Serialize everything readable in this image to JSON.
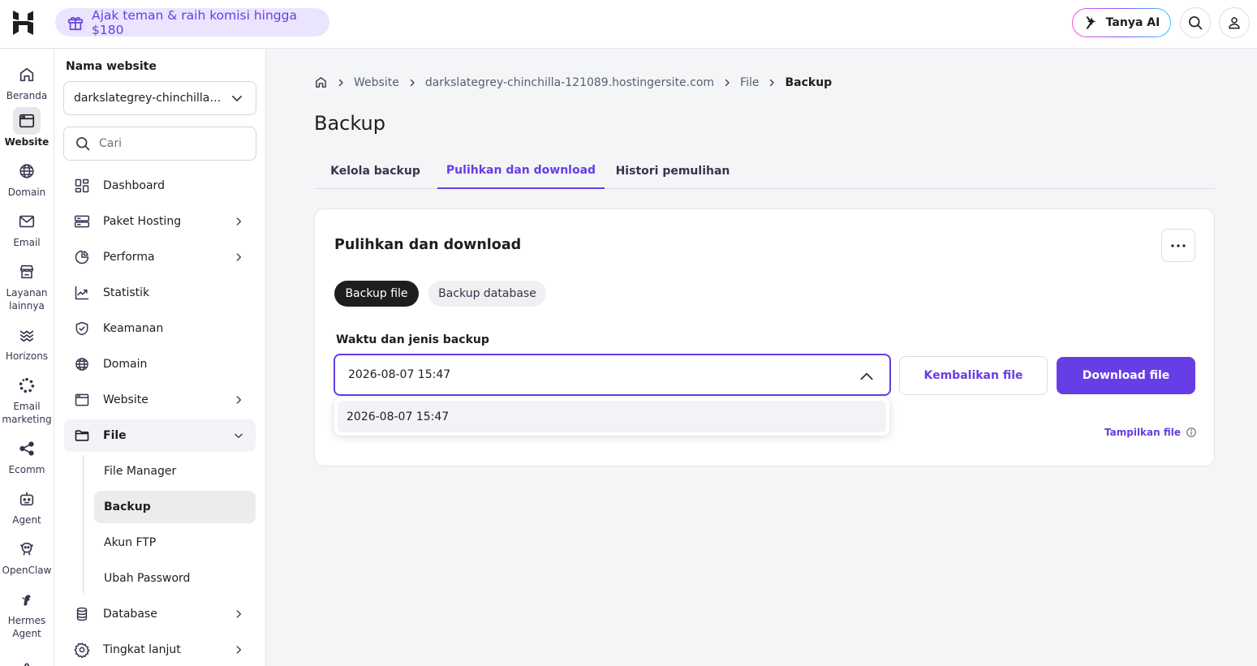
{
  "topbar": {
    "promo_text": "Ajak teman & raih komisi hingga $180",
    "ai_button": "Tanya AI"
  },
  "rail": {
    "items": [
      {
        "label": "Beranda",
        "icon": "home-icon"
      },
      {
        "label": "Website",
        "icon": "browser-icon"
      },
      {
        "label": "Domain",
        "icon": "globe-icon"
      },
      {
        "label": "Email",
        "icon": "mail-icon"
      },
      {
        "label": "Layanan lainnya",
        "icon": "store-icon"
      },
      {
        "label": "Horizons",
        "icon": "horizons-icon"
      },
      {
        "label": "Email marketing",
        "icon": "email-marketing-icon"
      },
      {
        "label": "Ecomm",
        "icon": "share-icon"
      },
      {
        "label": "Agent",
        "icon": "robot-icon"
      },
      {
        "label": "OpenClaw",
        "icon": "claw-icon"
      },
      {
        "label": "Hermes Agent",
        "icon": "hermes-icon"
      }
    ]
  },
  "sidebar": {
    "title": "Nama website",
    "site_selected": "darkslategrey-chinchilla-121089.hostingersite.com",
    "search_placeholder": "Cari",
    "items": [
      {
        "label": "Dashboard"
      },
      {
        "label": "Paket Hosting"
      },
      {
        "label": "Performa"
      },
      {
        "label": "Statistik"
      },
      {
        "label": "Keamanan"
      },
      {
        "label": "Domain"
      },
      {
        "label": "Website"
      },
      {
        "label": "File"
      },
      {
        "label": "Database"
      },
      {
        "label": "Tingkat lanjut"
      }
    ],
    "file_sub": [
      {
        "label": "File Manager"
      },
      {
        "label": "Backup"
      },
      {
        "label": "Akun FTP"
      },
      {
        "label": "Ubah Password"
      }
    ]
  },
  "breadcrumb": {
    "items": [
      "Website",
      "darkslategrey-chinchilla-121089.hostingersite.com",
      "File"
    ],
    "current": "Backup"
  },
  "page": {
    "title": "Backup",
    "tabs": [
      "Kelola backup",
      "Pulihkan dan download",
      "Histori pemulihan"
    ],
    "active_tab": "Pulihkan dan download"
  },
  "card": {
    "title": "Pulihkan dan download",
    "pills": [
      "Backup file",
      "Backup database"
    ],
    "field_label": "Waktu dan jenis backup",
    "selected_value": "2026-08-07 15:47",
    "restore_button": "Kembalikan file",
    "download_button": "Download file",
    "show_files": "Tampilkan file",
    "options": [
      "2026-08-07 15:47"
    ]
  },
  "colors": {
    "accent": "#673de6",
    "promo_bg": "#ebe4ff",
    "dark_pill": "#1d1e20"
  }
}
